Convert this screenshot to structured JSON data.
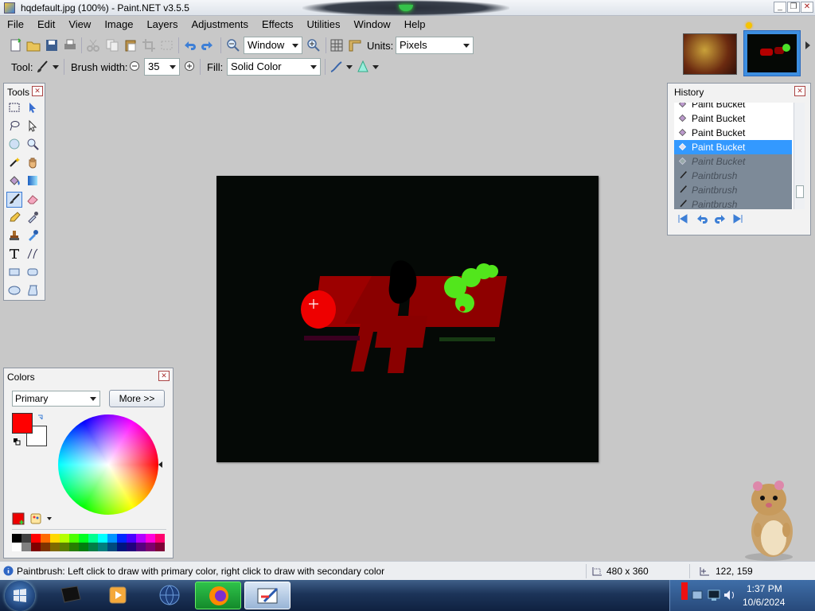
{
  "window": {
    "title": "hqdefault.jpg (100%) - Paint.NET v3.5.5"
  },
  "menu": [
    "File",
    "Edit",
    "View",
    "Image",
    "Layers",
    "Adjustments",
    "Effects",
    "Utilities",
    "Window",
    "Help"
  ],
  "toolbar": {
    "zoom_value": "Window",
    "units_label": "Units:",
    "units_value": "Pixels",
    "tool_label": "Tool:",
    "brush_width_label": "Brush width:",
    "brush_width_value": "35",
    "fill_label": "Fill:",
    "fill_value": "Solid Color"
  },
  "tools_panel": {
    "title": "Tools"
  },
  "history_panel": {
    "title": "History",
    "items": [
      {
        "label": "Paint Bucket",
        "state": "done",
        "icon": "paint-bucket-icon"
      },
      {
        "label": "Paint Bucket",
        "state": "done",
        "icon": "paint-bucket-icon"
      },
      {
        "label": "Paint Bucket",
        "state": "done",
        "icon": "paint-bucket-icon"
      },
      {
        "label": "Paint Bucket",
        "state": "selected",
        "icon": "paint-bucket-icon"
      },
      {
        "label": "Paint Bucket",
        "state": "undone",
        "icon": "paint-bucket-icon"
      },
      {
        "label": "Paintbrush",
        "state": "undone",
        "icon": "paintbrush-icon"
      },
      {
        "label": "Paintbrush",
        "state": "undone",
        "icon": "paintbrush-icon"
      },
      {
        "label": "Paintbrush",
        "state": "undone",
        "icon": "paintbrush-icon"
      }
    ]
  },
  "colors_panel": {
    "title": "Colors",
    "mode": "Primary",
    "more_button": "More >>",
    "primary_color": "#ff0000",
    "secondary_color": "#ffffff",
    "palette": [
      "#000000",
      "#404040",
      "#ff0000",
      "#ff6a00",
      "#ffd800",
      "#b6ff00",
      "#4cff00",
      "#00ff21",
      "#00ff90",
      "#00ffff",
      "#0094ff",
      "#0026ff",
      "#4800ff",
      "#b200ff",
      "#ff00dc",
      "#ff006e",
      "#ffffff",
      "#808080",
      "#7f0000",
      "#7f3300",
      "#7f6a00",
      "#5b7f00",
      "#267f00",
      "#007f0e",
      "#007f46",
      "#007f7f",
      "#004a7f",
      "#00137f",
      "#21007f",
      "#57007f",
      "#7f006e",
      "#7f0037"
    ]
  },
  "status": {
    "hint": "Paintbrush: Left click to draw with primary color, right click to draw with secondary color",
    "image_size": "480 x 360",
    "cursor_pos": "122, 159"
  },
  "taskbar": {
    "time": "1:37 PM",
    "date": "10/6/2024"
  },
  "canvas": {
    "background": "#050906"
  }
}
